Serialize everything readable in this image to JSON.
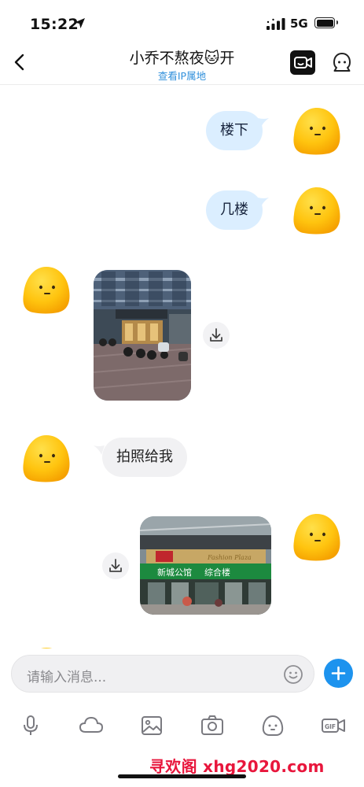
{
  "status_bar": {
    "time": "15:22",
    "network": "5G",
    "icons": [
      "location-arrow-icon",
      "signal-icon",
      "battery-icon"
    ]
  },
  "header": {
    "title": "小乔不熬夜🐱开",
    "subtitle": "查看IP属地",
    "icons": [
      "back-chevron-icon",
      "video-call-icon",
      "profile-icon"
    ]
  },
  "messages": [
    {
      "direction": "outgoing",
      "type": "text",
      "text": "楼下"
    },
    {
      "direction": "outgoing",
      "type": "text",
      "text": "几楼"
    },
    {
      "direction": "incoming",
      "type": "image",
      "description_icon": "street-photo-icon"
    },
    {
      "direction": "incoming",
      "type": "text",
      "text": "拍照给我"
    },
    {
      "direction": "outgoing",
      "type": "image",
      "description_icon": "storefront-photo-icon"
    }
  ],
  "photo2_sign": {
    "text": "综合楼",
    "banner": "新城公馆",
    "script": "Fashion Plaza"
  },
  "composer": {
    "placeholder": "请输入消息...",
    "icons": [
      "emoji-icon",
      "plus-icon"
    ]
  },
  "toolbar": {
    "items": [
      "microphone-icon",
      "cloud-icon",
      "image-icon",
      "camera-icon",
      "sticker-icon",
      "gif-icon"
    ]
  },
  "watermark": "寻欢阁 xhg2020.com",
  "colors": {
    "accent": "#1d93ee",
    "outgoing_bubble": "#dbeeff",
    "incoming_bubble": "#f1f1f3",
    "link": "#2f8fdb",
    "avatar_yellow": "#ffc20e",
    "watermark": "#e8163c"
  }
}
